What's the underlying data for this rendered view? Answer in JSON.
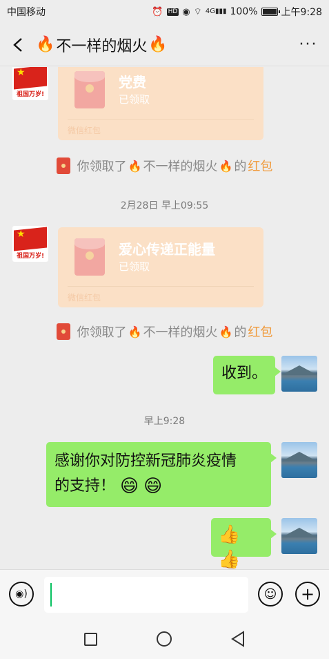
{
  "status_bar": {
    "carrier": "中国移动",
    "icons": [
      "alarm-icon",
      "hd-icon",
      "eye-icon",
      "wifi-icon",
      "signal-4g-icon",
      "battery-icon"
    ],
    "signal_label": "4G",
    "battery_percent": "100%",
    "time": "上午9:28"
  },
  "header": {
    "title": "不一样的烟火",
    "title_decoration": "🔥",
    "more_label": "···"
  },
  "messages": {
    "rp1": {
      "title": "党费",
      "status": "已领取",
      "footer": "微信红包",
      "avatar_caption": "祖国万岁!"
    },
    "sys1": {
      "prefix": "你领取了",
      "name": "不一样的烟火",
      "suffix": "的",
      "link": "红包"
    },
    "time1": "2月28日 早上09:55",
    "rp2": {
      "title": "爱心传递正能量",
      "status": "已领取",
      "footer": "微信红包",
      "avatar_caption": "祖国万岁!"
    },
    "sys2": {
      "prefix": "你领取了",
      "name": "不一样的烟火",
      "suffix": "的",
      "link": "红包"
    },
    "bubble1": "收到。",
    "time2": "早上9:28",
    "bubble2_line1": "感谢你对防控新冠肺炎疫情",
    "bubble2_line2": "的支持！",
    "bubble2_emoji": "😄",
    "bubble3_emoji": "👍"
  },
  "input_bar": {
    "value": "",
    "voice_label": "◉)",
    "emoji_label": "☺",
    "plus_label": "+"
  },
  "colors": {
    "bubble_green": "#95ec69",
    "red_packet": "#fbe0c6",
    "link_orange": "#f09a3b",
    "background": "#ededed"
  }
}
